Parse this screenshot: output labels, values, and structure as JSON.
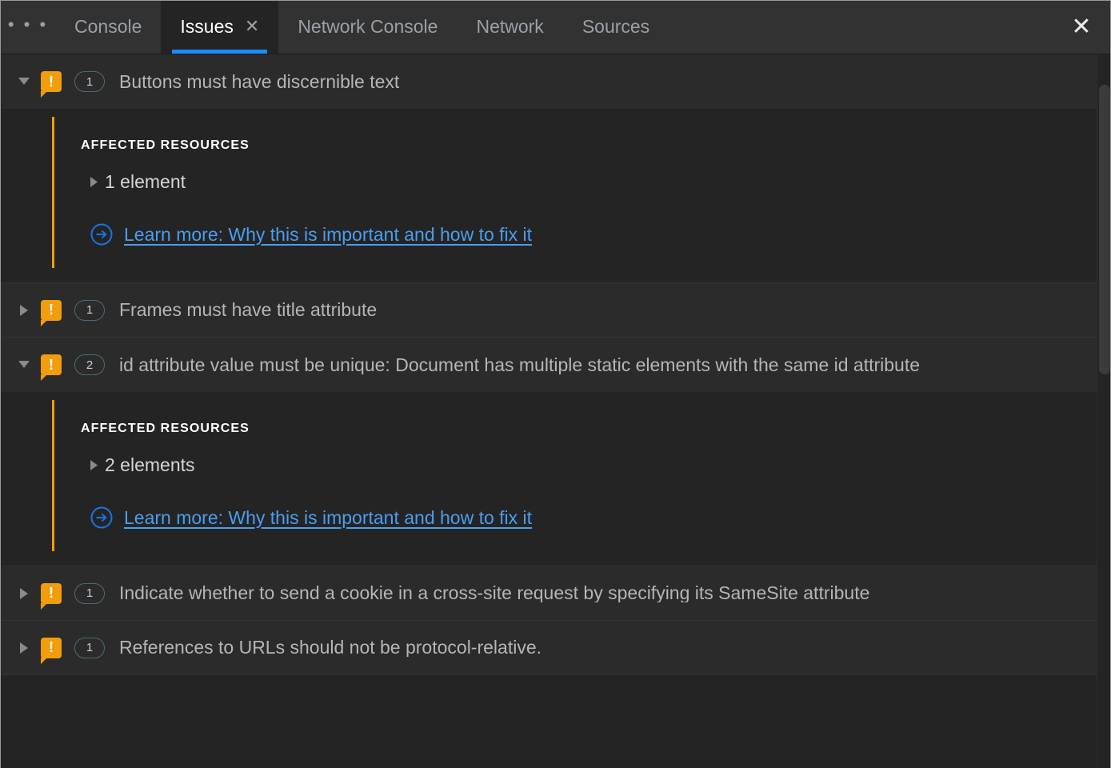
{
  "window": {
    "accent_blue": "#1a8cff",
    "warning_orange": "#f29d0b",
    "link_blue": "#4a9df0"
  },
  "tabbar": {
    "more_label": "• • •",
    "more_icon": "more-horizontal-icon",
    "close_icon": "close-icon",
    "panel_close_label": "✕",
    "tab_close_label": "✕",
    "tabs": [
      {
        "label": "Console",
        "active": false
      },
      {
        "label": "Issues",
        "active": true
      },
      {
        "label": "Network Console",
        "active": false
      },
      {
        "label": "Network",
        "active": false
      },
      {
        "label": "Sources",
        "active": false
      }
    ]
  },
  "issues": {
    "affected_resources_label": "AFFECTED RESOURCES",
    "learn_more_label": "Learn more: Why this is important and how to fix it",
    "list": [
      {
        "severity_icon": "warning-icon",
        "count": "1",
        "title": "Buttons must have discernible text",
        "expanded": true,
        "resource_label": "1 element"
      },
      {
        "severity_icon": "warning-icon",
        "count": "1",
        "title": "Frames must have title attribute",
        "expanded": false,
        "resource_label": ""
      },
      {
        "severity_icon": "warning-icon",
        "count": "2",
        "title": "id attribute value must be unique: Document has multiple static elements with the same id attribute",
        "expanded": true,
        "resource_label": "2 elements"
      },
      {
        "severity_icon": "warning-icon",
        "count": "1",
        "title": "Indicate whether to send a cookie in a cross-site request by specifying its SameSite attribute",
        "expanded": false,
        "resource_label": ""
      },
      {
        "severity_icon": "warning-icon",
        "count": "1",
        "title": "References to URLs should not be protocol-relative.",
        "expanded": false,
        "resource_label": ""
      }
    ]
  }
}
